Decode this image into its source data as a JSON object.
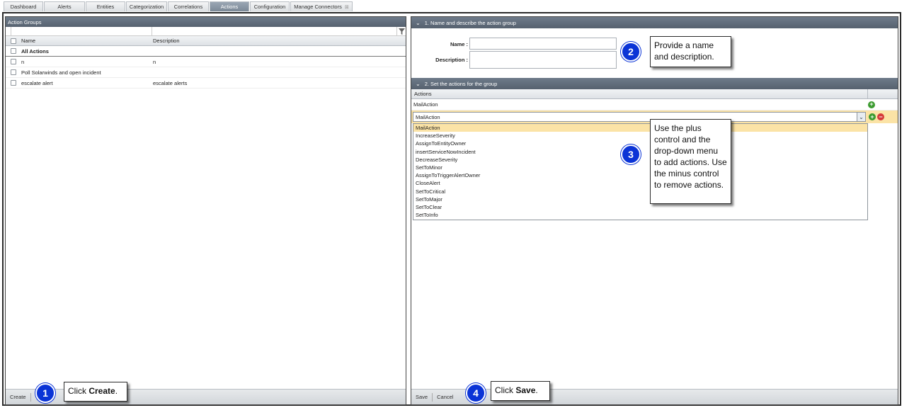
{
  "tabs": [
    {
      "label": "Dashboard",
      "active": false
    },
    {
      "label": "Alerts",
      "active": false
    },
    {
      "label": "Entities",
      "active": false
    },
    {
      "label": "Categorization",
      "active": false
    },
    {
      "label": "Correlations",
      "active": false
    },
    {
      "label": "Actions",
      "active": true
    },
    {
      "label": "Configuration",
      "active": false
    },
    {
      "label": "Manage Connectors",
      "active": false
    }
  ],
  "left": {
    "title": "Action Groups",
    "columns": {
      "name": "Name",
      "description": "Description"
    },
    "all_actions": "All Actions",
    "rows": [
      {
        "name": "n",
        "description": "n"
      },
      {
        "name": "Poll Solarwinds and open incident",
        "description": ""
      },
      {
        "name": "escalate alert",
        "description": "escalate alerts"
      }
    ],
    "footer": {
      "create": "Create"
    }
  },
  "right": {
    "section1": "1. Name and describe the action group",
    "name_label": "Name :",
    "description_label": "Description :",
    "section2": "2. Set the actions for the group",
    "actions_header": "Actions",
    "action_row": "MailAction",
    "dropdown_value": "MailAction",
    "dropdown_options": [
      "MailAction",
      "IncreaseSeverity",
      "AssignToEntityOwner",
      "insertServiceNowIncident",
      "DecreaseSeverity",
      "SetToMinor",
      "AssignToTriggerAlertOwner",
      "CloseAlert",
      "SetToCritical",
      "SetToMajor",
      "SetToClear",
      "SetToInfo"
    ],
    "footer": {
      "save": "Save",
      "cancel": "Cancel"
    }
  },
  "callouts": {
    "c1": {
      "num": "1",
      "text_pre": "Click ",
      "text_bold": "Create",
      "text_post": "."
    },
    "c2": {
      "num": "2",
      "text": "Provide a name and description."
    },
    "c3": {
      "num": "3",
      "text": "Use the plus control and the drop-down menu to add actions. Use the minus control to remove actions."
    },
    "c4": {
      "num": "4",
      "text_pre": "Click ",
      "text_bold": "Save",
      "text_post": "."
    }
  },
  "colors": {
    "header": "#5f6b79",
    "badge": "#0b34d6",
    "selected": "#fbe3a6"
  }
}
